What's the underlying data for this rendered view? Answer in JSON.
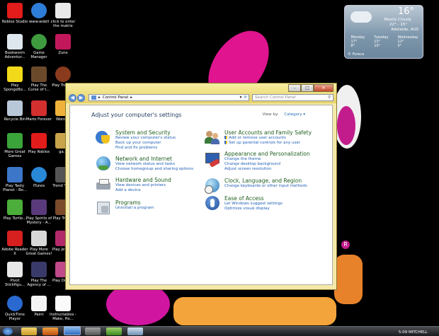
{
  "desktop": {
    "icons": [
      {
        "label": "Roblox Studio"
      },
      {
        "label": "www.wdell"
      },
      {
        "label": "click to enter the matrix"
      },
      {
        "label": "Bookworm Adventur..."
      },
      {
        "label": "Game Manager"
      },
      {
        "label": "Zune"
      },
      {
        "label": "Play SpongeBo..."
      },
      {
        "label": "Play The Curse of t..."
      },
      {
        "label": "Play Treas..."
      },
      {
        "label": "Recycle Bin"
      },
      {
        "label": "Mario Forever"
      },
      {
        "label": "Wond..."
      },
      {
        "label": "More Great Games"
      },
      {
        "label": "Play Roblox"
      },
      {
        "label": "ga..."
      },
      {
        "label": "Play Tasty Planet - Be..."
      },
      {
        "label": "iTunes"
      },
      {
        "label": "Trend Titan"
      },
      {
        "label": "Play Turtle..."
      },
      {
        "label": "Play Spirits of Mystery - A..."
      },
      {
        "label": "Play Trea..."
      },
      {
        "label": "Adobe Reader X"
      },
      {
        "label": "Play More Great Games!"
      },
      {
        "label": "Play Jewe..."
      },
      {
        "label": "Pivot Stickfigu..."
      },
      {
        "label": "Play The Agency of ..."
      },
      {
        "label": "Play Dres..."
      },
      {
        "label": "QuickTime Player"
      },
      {
        "label": "Paint"
      },
      {
        "label": "Instructables - Make, Ho..."
      }
    ]
  },
  "weather": {
    "temp": "16°",
    "condition": "Mostly Cloudy",
    "range": "22° - 15°",
    "location": "Adelaide, AUS",
    "days": [
      {
        "name": "Monday",
        "hi": "17°",
        "lo": "8°"
      },
      {
        "name": "Tuesday",
        "hi": "13°",
        "lo": "10°"
      },
      {
        "name": "Wednesday",
        "hi": "12°",
        "lo": "5°"
      }
    ],
    "provider": "© Foreca"
  },
  "window": {
    "address": "Control Panel",
    "search_placeholder": "Search Control Panel",
    "heading": "Adjust your computer's settings",
    "view_by_label": "View by:",
    "view_by_value": "Category",
    "left_items": [
      {
        "title": "System and Security",
        "links": [
          "Review your computer's status",
          "Back up your computer",
          "Find and fix problems"
        ]
      },
      {
        "title": "Network and Internet",
        "links": [
          "View network status and tasks",
          "Choose homegroup and sharing options"
        ]
      },
      {
        "title": "Hardware and Sound",
        "links": [
          "View devices and printers",
          "Add a device"
        ]
      },
      {
        "title": "Programs",
        "links": [
          "Uninstall a program"
        ]
      }
    ],
    "right_items": [
      {
        "title": "User Accounts and Family Safety",
        "links": [
          "Add or remove user accounts",
          "Set up parental controls for any user"
        ]
      },
      {
        "title": "Appearance and Personalization",
        "links": [
          "Change the theme",
          "Change desktop background",
          "Adjust screen resolution"
        ]
      },
      {
        "title": "Clock, Language, and Region",
        "links": [
          "Change keyboards or other input methods"
        ]
      },
      {
        "title": "Ease of Access",
        "links": [
          "Let Windows suggest settings",
          "Optimize visual display"
        ]
      }
    ]
  },
  "taskbar": {
    "clock": "5:09 MITCHELL"
  },
  "colors": {
    "window_frame": "#f4e9a8",
    "link": "#1f5fb5",
    "category_title": "#1e5e1e"
  }
}
